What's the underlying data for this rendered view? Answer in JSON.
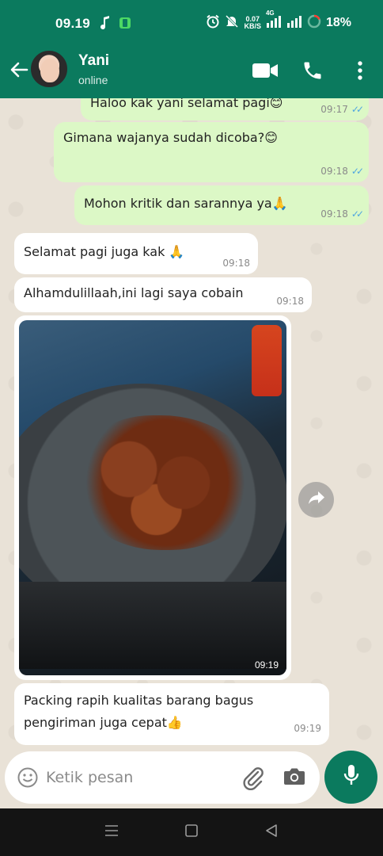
{
  "status_bar": {
    "time": "09.19",
    "net_speed_value": "0.07",
    "net_speed_unit": "KB/S",
    "network_type": "4G",
    "battery_percent": "18%"
  },
  "header": {
    "contact_name": "Yani",
    "contact_status": "online"
  },
  "messages": [
    {
      "direction": "outgoing",
      "text": "Haloo kak yani selamat pagi😊",
      "time": "09:17",
      "read": true
    },
    {
      "direction": "outgoing",
      "text": "Gimana wajanya sudah dicoba?😊",
      "time": "09:18",
      "read": true
    },
    {
      "direction": "outgoing",
      "text": "Mohon kritik dan sarannya ya🙏",
      "time": "09:18",
      "read": true
    },
    {
      "direction": "incoming",
      "text": "Selamat pagi juga kak 🙏",
      "time": "09:18"
    },
    {
      "direction": "incoming",
      "text": "Alhamdulillaah,ini lagi saya cobain",
      "time": "09:18"
    },
    {
      "direction": "incoming",
      "type": "image",
      "time": "09:19"
    },
    {
      "direction": "incoming",
      "text": "Packing rapih kualitas barang bagus pengiriman juga cepat👍",
      "time": "09:19"
    }
  ],
  "input": {
    "placeholder": "Ketik pesan"
  },
  "colors": {
    "brand": "#0b7a5e",
    "outgoing_bubble": "#dcf8c6",
    "incoming_bubble": "#ffffff",
    "read_ticks": "#4fa6e0",
    "chat_background": "#e9e2d7"
  },
  "icons": [
    "back-arrow-icon",
    "video-call-icon",
    "phone-icon",
    "more-vert-icon",
    "emoji-icon",
    "attach-icon",
    "camera-icon",
    "mic-icon",
    "forward-icon",
    "menu-icon",
    "home-icon",
    "back-nav-icon"
  ]
}
